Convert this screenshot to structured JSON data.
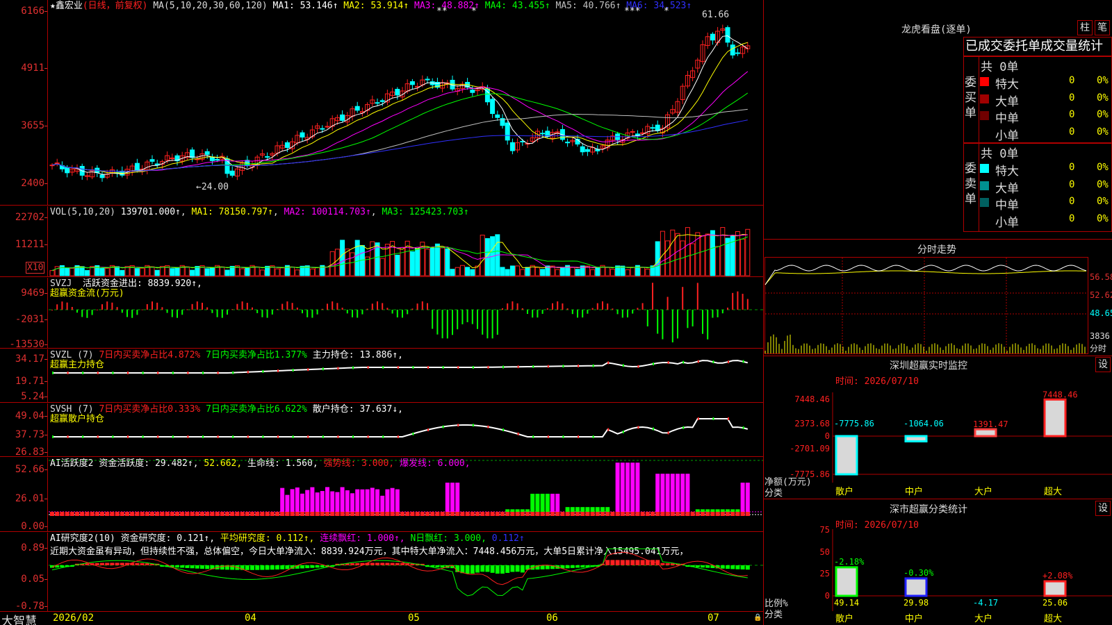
{
  "colors": {
    "up": "#ff2020",
    "down": "#00ffff",
    "ma1": "#ffffff",
    "ma2": "#ffff00",
    "ma3": "#ff00ff",
    "ma4": "#00ff00",
    "ma5": "#c0c0c0",
    "ma6": "#3030ff"
  },
  "main": {
    "title": "★鑫宏业",
    "period": "(日线，前复权)",
    "ma_label": "MA(5,10,20,30,60,120)",
    "mas": [
      {
        "name": "MA1:",
        "value": "53.146↑",
        "color": "#ffffff"
      },
      {
        "name": "MA2:",
        "value": "53.914↑",
        "color": "#ffff00"
      },
      {
        "name": "MA3:",
        "value": "48.882↑",
        "color": "#ff00ff"
      },
      {
        "name": "MA4:",
        "value": "43.455↑",
        "color": "#00ff00"
      },
      {
        "name": "MA5:",
        "value": "40.766↑",
        "color": "#c0c0c0"
      },
      {
        "name": "MA6:",
        "value": "34.523↑",
        "color": "#3030ff"
      }
    ],
    "y_ticks": [
      "6166",
      "4911",
      "3655",
      "2400"
    ],
    "high_label": "61.66",
    "low_label": "←24.00",
    "star_marks": [
      "**",
      "*",
      "***",
      "*"
    ]
  },
  "vol": {
    "label": "VOL(5,10,20)",
    "value": "139701.000↑",
    "ma1": "MA1: 78150.797↑",
    "ma2": "MA2: 100114.703↑",
    "ma3": "MA3: 125423.703↑",
    "y_ticks": [
      "22702",
      "11211"
    ],
    "unit": "X10"
  },
  "svzj": {
    "label": "SVZJ",
    "desc": "活跃资金进出: 8839.920↑,",
    "sub": "超赢资金流(万元)",
    "y_ticks": [
      "9469",
      "-2031",
      "-13530"
    ]
  },
  "svzl": {
    "label": "SVZL (7)",
    "p1": "7日内买卖净占比4.872%",
    "p2": "7日内买卖净占比1.377%",
    "p3": "主力持仓: 13.886↑,",
    "sub": "超赢主力持仓",
    "y_ticks": [
      "34.17",
      "19.71",
      "5.24"
    ]
  },
  "svsh": {
    "label": "SVSH (7)",
    "p1": "7日内买卖净占比0.333%",
    "p2": "7日内买卖净占比6.622%",
    "p3": "散户持仓: 37.637↓,",
    "sub": "超赢散户持仓",
    "y_ticks": [
      "49.04",
      "37.73",
      "26.83"
    ]
  },
  "ai2": {
    "label": "AI活跃度2",
    "p1": "资金活跃度: 29.482↑,",
    "p2": "52.662,",
    "p3": "生命线: 1.560,",
    "p4": "强势线: 3.000,",
    "p5": "爆发线: 6.000,",
    "y_ticks": [
      "52.66",
      "26.01",
      "0.00"
    ]
  },
  "ai_study": {
    "label": "AI研究度2(10)",
    "p1": "资金研究度: 0.121↑,",
    "p2": "平均研究度: 0.112↑,",
    "p3": "连续飘红: 1.000↑,",
    "p4": "N日飘红: 3.000,",
    "p5": "0.112↑",
    "comment": "近期大资金虽有异动，但持续性不强，总体偏空，今日大单净流入：8839.924万元，其中特大单净流入：7448.456万元，大单5日累计净入15495.041万元，",
    "y_ticks": [
      "0.89",
      "0.05",
      "-0.78"
    ]
  },
  "dates": {
    "brand": "大智慧",
    "labels": [
      "2026/02",
      "04",
      "05",
      "06",
      "07"
    ]
  },
  "lhb": {
    "title": "龙虎看盘(逐单)",
    "btn1": "柱",
    "btn2": "笔",
    "tabs": "已成交委托单成交量统计",
    "buy_total": "共 0单",
    "sell_total": "共 0单",
    "buy_label": "委买单",
    "sell_label": "委卖单",
    "buy_rows": [
      {
        "name": "特大",
        "v1": "0",
        "v2": "0%",
        "color": "#ff0000"
      },
      {
        "name": "大单",
        "v1": "0",
        "v2": "0%",
        "color": "#a00000"
      },
      {
        "name": "中单",
        "v1": "0",
        "v2": "0%",
        "color": "#700000"
      },
      {
        "name": "小单",
        "v1": "0",
        "v2": "0%",
        "color": "#000000"
      }
    ],
    "sell_rows": [
      {
        "name": "特大",
        "v1": "0",
        "v2": "0%",
        "color": "#00ffff"
      },
      {
        "name": "大单",
        "v1": "0",
        "v2": "0%",
        "color": "#009090"
      },
      {
        "name": "中单",
        "v1": "0",
        "v2": "0%",
        "color": "#006060"
      },
      {
        "name": "小单",
        "v1": "0",
        "v2": "0%",
        "color": "#000000"
      }
    ]
  },
  "intraday": {
    "title": "分时走势",
    "y_ticks": [
      "56.58",
      "52.62",
      "48.65",
      "3836"
    ],
    "unit": "分时"
  },
  "sz_monitor": {
    "title": "深圳超赢实时监控",
    "btn": "设",
    "time": "时间: 2026/07/10",
    "unit": "净额(万元)",
    "cat_label": "分类",
    "y_ticks": [
      "7448.46",
      "2373.68",
      "0",
      "-2701.09",
      "-7775.86"
    ],
    "bars": [
      {
        "cat": "散户",
        "value": -7775.86,
        "label": "-7775.86"
      },
      {
        "cat": "中户",
        "value": -1064.06,
        "label": "-1064.06"
      },
      {
        "cat": "大户",
        "value": 1391.47,
        "label": "1391.47"
      },
      {
        "cat": "超大",
        "value": 7448.46,
        "label": "7448.46"
      }
    ]
  },
  "sz_class": {
    "title": "深市超赢分类统计",
    "btn": "设",
    "time": "时间: 2026/07/10",
    "unit": "比例%",
    "cat_label": "分类",
    "y_ticks": [
      "75",
      "50",
      "25",
      "0"
    ],
    "bars": [
      {
        "cat": "散户",
        "value": 49.14,
        "label": "49.14",
        "change": "-2.18%"
      },
      {
        "cat": "中户",
        "value": 29.98,
        "label": "29.98",
        "change": "-0.30%"
      },
      {
        "cat": "大户",
        "value": -4.17,
        "label": "-4.17",
        "change": ""
      },
      {
        "cat": "超大",
        "value": 25.06,
        "label": "25.06",
        "change": "+2.08%"
      }
    ]
  }
}
